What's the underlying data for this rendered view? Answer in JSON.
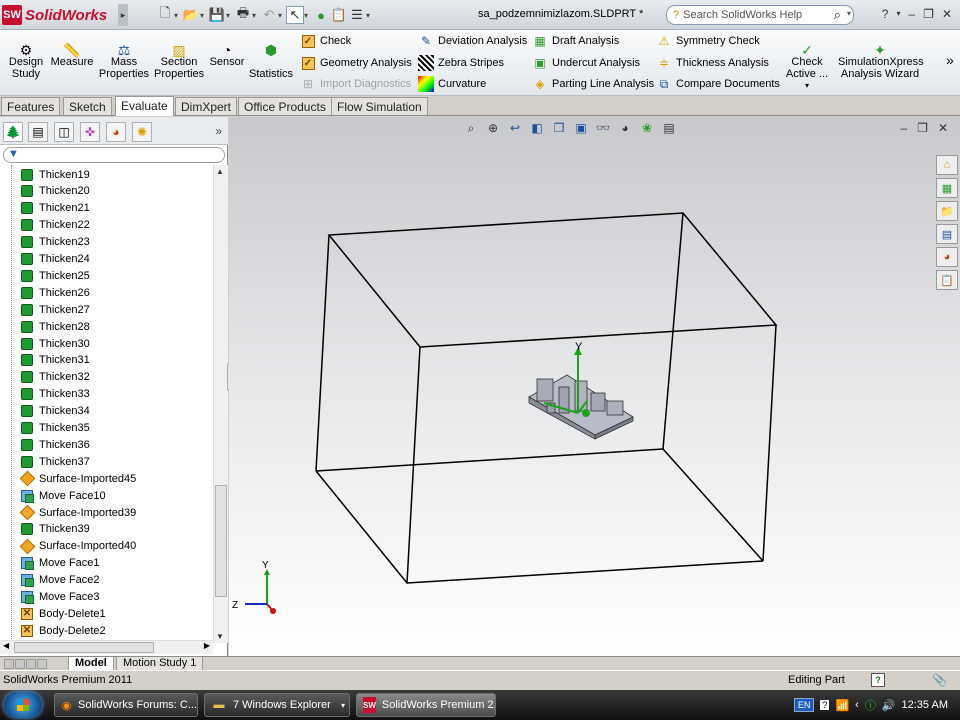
{
  "app": {
    "logo_text": "SolidWorks",
    "logo_badge": "SW",
    "document_title": "sa_podzemnimizlazom.SLDPRT *",
    "search_placeholder": "Search SolidWorks Help"
  },
  "ribbon": {
    "big_buttons": [
      {
        "label1": "Design",
        "label2": "Study",
        "icon": "design-study-icon"
      },
      {
        "label1": "Measure",
        "label2": "",
        "icon": "measure-icon"
      },
      {
        "label1": "Mass",
        "label2": "Properties",
        "icon": "mass-properties-icon"
      },
      {
        "label1": "Section",
        "label2": "Properties",
        "icon": "section-properties-icon"
      },
      {
        "label1": "Sensor",
        "label2": "",
        "icon": "sensor-icon"
      },
      {
        "label1": "Statistics",
        "label2": "",
        "icon": "statistics-icon"
      }
    ],
    "check_group": {
      "check": "Check",
      "geometry_analysis": "Geometry Analysis",
      "import_diagnostics": "Import Diagnostics"
    },
    "analysis_group_1": {
      "deviation": "Deviation Analysis",
      "zebra": "Zebra Stripes",
      "curvature": "Curvature"
    },
    "analysis_group_2": {
      "draft": "Draft Analysis",
      "undercut": "Undercut Analysis",
      "parting": "Parting Line Analysis"
    },
    "analysis_group_3": {
      "symmetry": "Symmetry Check",
      "thickness": "Thickness Analysis",
      "compare": "Compare Documents"
    },
    "check_active": {
      "label1": "Check",
      "label2": "Active ..."
    },
    "simxpress": {
      "label1": "SimulationXpress",
      "label2": "Analysis Wizard"
    }
  },
  "command_tabs": [
    "Features",
    "Sketch",
    "Evaluate",
    "DimXpert",
    "Office Products",
    "Flow Simulation"
  ],
  "active_command_tab": "Evaluate",
  "feature_tree": {
    "items": [
      {
        "label": "Thicken19",
        "type": "thicken"
      },
      {
        "label": "Thicken20",
        "type": "thicken"
      },
      {
        "label": "Thicken21",
        "type": "thicken"
      },
      {
        "label": "Thicken22",
        "type": "thicken"
      },
      {
        "label": "Thicken23",
        "type": "thicken"
      },
      {
        "label": "Thicken24",
        "type": "thicken"
      },
      {
        "label": "Thicken25",
        "type": "thicken"
      },
      {
        "label": "Thicken26",
        "type": "thicken"
      },
      {
        "label": "Thicken27",
        "type": "thicken"
      },
      {
        "label": "Thicken28",
        "type": "thicken"
      },
      {
        "label": "Thicken30",
        "type": "thicken"
      },
      {
        "label": "Thicken31",
        "type": "thicken"
      },
      {
        "label": "Thicken32",
        "type": "thicken"
      },
      {
        "label": "Thicken33",
        "type": "thicken"
      },
      {
        "label": "Thicken34",
        "type": "thicken"
      },
      {
        "label": "Thicken35",
        "type": "thicken"
      },
      {
        "label": "Thicken36",
        "type": "thicken"
      },
      {
        "label": "Thicken37",
        "type": "thicken"
      },
      {
        "label": "Surface-Imported45",
        "type": "surface"
      },
      {
        "label": "Move Face10",
        "type": "move"
      },
      {
        "label": "Surface-Imported39",
        "type": "surface"
      },
      {
        "label": "Thicken39",
        "type": "thicken"
      },
      {
        "label": "Surface-Imported40",
        "type": "surface"
      },
      {
        "label": "Move Face1",
        "type": "move"
      },
      {
        "label": "Move Face2",
        "type": "move"
      },
      {
        "label": "Move Face3",
        "type": "move"
      },
      {
        "label": "Body-Delete1",
        "type": "delete"
      },
      {
        "label": "Body-Delete2",
        "type": "delete"
      }
    ]
  },
  "bottom_tabs": [
    "Model",
    "Motion Study 1"
  ],
  "active_bottom_tab": "Model",
  "viewport": {
    "axis_y_label": "Y",
    "triad_y": "Y",
    "triad_z": "Z"
  },
  "status_bar": {
    "left": "SolidWorks Premium 2011",
    "right": "Editing Part"
  },
  "taskbar": {
    "buttons": [
      {
        "label": "SolidWorks Forums: C...",
        "icon": "firefox-icon"
      },
      {
        "label": "7 Windows Explorer",
        "icon": "folder-icon"
      },
      {
        "label": "SolidWorks Premium 2...",
        "icon": "solidworks-icon"
      }
    ],
    "lang": "EN",
    "time": "12:35 AM"
  },
  "colors": {
    "brand_red": "#c8102e",
    "thicken_green": "#1f9b2f",
    "surface_orange": "#f5a623",
    "axis_green": "#1ba31b",
    "axis_red": "#d01010",
    "axis_blue": "#1030c0"
  }
}
